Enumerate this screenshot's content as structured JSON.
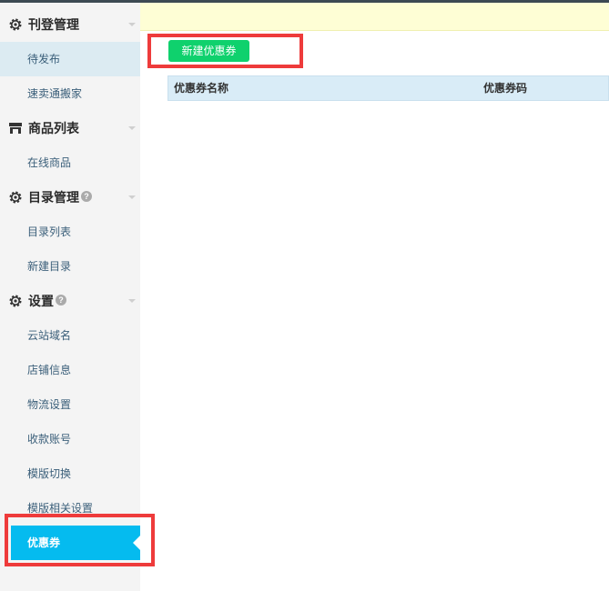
{
  "sidebar": {
    "groups": [
      {
        "title": "刊登管理",
        "icon": "gear-icon",
        "items": [
          "待发布",
          "速卖通搬家"
        ]
      },
      {
        "title": "商品列表",
        "icon": "store-icon",
        "items": [
          "在线商品"
        ]
      },
      {
        "title": "目录管理",
        "icon": "gear-icon",
        "help": "?",
        "items": [
          "目录列表",
          "新建目录"
        ]
      },
      {
        "title": "设置",
        "icon": "gear-icon",
        "help": "?",
        "items": [
          "云站域名",
          "店铺信息",
          "物流设置",
          "收款账号",
          "模版切换",
          "模版相关设置",
          "优惠券"
        ]
      }
    ],
    "highlighted_item": "待发布",
    "active_item": "优惠券"
  },
  "main": {
    "new_coupon_button": "新建优惠券",
    "table": {
      "columns": [
        "优惠券名称",
        "优惠券码"
      ]
    }
  },
  "colors": {
    "accent": "#05bbef",
    "button": "#0fd16d",
    "highlight_box": "#ee3b3b",
    "notice_bg": "#fefed5"
  }
}
